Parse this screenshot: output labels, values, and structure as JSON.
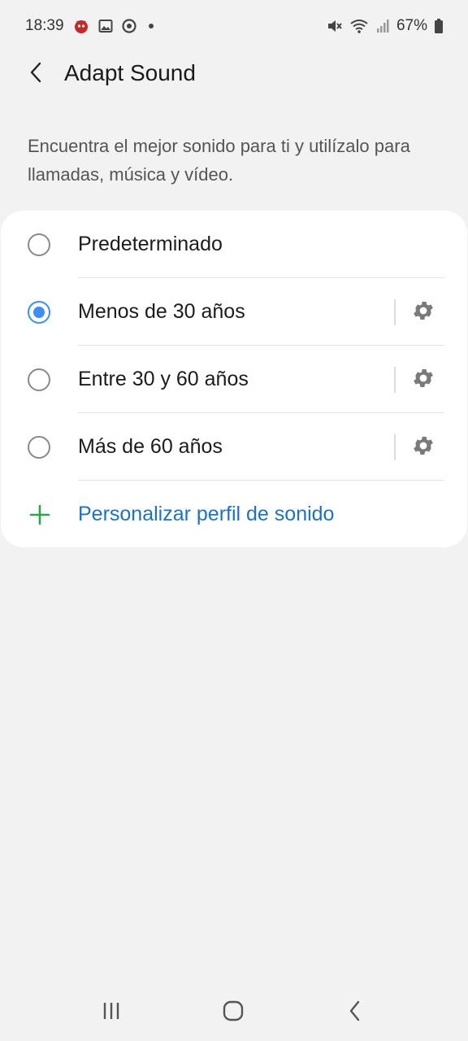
{
  "status_bar": {
    "time": "18:39",
    "battery": "67%",
    "icons": [
      "app-notification-icon",
      "image-icon",
      "record-icon",
      "mute-icon",
      "wifi-icon",
      "signal-icon",
      "battery-icon"
    ]
  },
  "header": {
    "title": "Adapt Sound",
    "back_icon": "chevron-left-icon"
  },
  "description": "Encuentra el mejor sonido para ti y utilízalo para llamadas, música y vídeo.",
  "options": [
    {
      "label": "Predeterminado",
      "selected": false,
      "has_settings": false
    },
    {
      "label": "Menos de 30 años",
      "selected": true,
      "has_settings": true
    },
    {
      "label": "Entre 30 y 60 años",
      "selected": false,
      "has_settings": true
    },
    {
      "label": "Más de 60 años",
      "selected": false,
      "has_settings": true
    }
  ],
  "add_profile": {
    "label": "Personalizar perfil de sonido",
    "icon": "plus-icon"
  },
  "colors": {
    "accent": "#3e8df4",
    "link": "#1a73c9",
    "plus": "#2ea44f",
    "background": "#f2f2f2"
  },
  "nav_bar": {
    "buttons": [
      "recent-apps-icon",
      "home-icon",
      "back-icon"
    ]
  }
}
